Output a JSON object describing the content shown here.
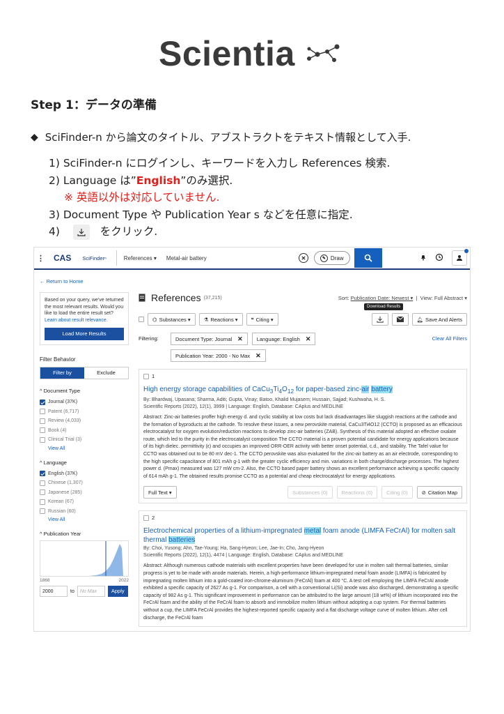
{
  "logo": {
    "text": "Scientia"
  },
  "step_title": "Step 1：データの準備",
  "bullet": {
    "mark": "◆",
    "text": "SciFinder-n から論文のタイトル、アブストラクトをテキスト情報として入手."
  },
  "steps": {
    "s1": "1) SciFinder-n にログインし、キーワードを入力し References 検索.",
    "s2_a": "2) Language は”",
    "s2_red": "English",
    "s2_b": "”のみ選択.",
    "note": "※ 英語以外は対応していません.",
    "s3": "3) Document Type や Publication Year s などを任意に指定.",
    "s4_num": "4)",
    "s4_text": "をクリック."
  },
  "app": {
    "brand": "CAS",
    "product": "SciFinderⁿ",
    "search_type": "References ▾",
    "search_value": "Metal-air battery",
    "draw_label": "Draw",
    "return_link": "←  Return to Home",
    "side_msg": "Based on your query, we've returned the most relevant results. Would you like to load the entire result set?",
    "learn_more": "Learn about result relevance.",
    "load_more": "Load More Results",
    "filter_behavior": "Filter Behavior",
    "filter_by": "Filter by",
    "exclude": "Exclude",
    "doc_type": {
      "header": "^  Document Type",
      "items": [
        {
          "label": "Journal (37K)",
          "on": true
        },
        {
          "label": "Patent (6,717)",
          "on": false
        },
        {
          "label": "Review (4,033)",
          "on": false
        },
        {
          "label": "Book (4)",
          "on": false
        },
        {
          "label": "Clinical Trial (3)",
          "on": false
        }
      ],
      "view_all": "View All"
    },
    "language": {
      "header": "^  Language",
      "items": [
        {
          "label": "English (37K)",
          "on": true
        },
        {
          "label": "Chinese (1,307)",
          "on": false
        },
        {
          "label": "Japanese (285)",
          "on": false
        },
        {
          "label": "Korean (67)",
          "on": false
        },
        {
          "label": "Russian (60)",
          "on": false
        }
      ],
      "view_all": "View All"
    },
    "pub_year": {
      "header": "^  Publication Year",
      "axis_start": "1868",
      "axis_end": "2022",
      "from_value": "2000",
      "to_label": "to",
      "to_placeholder": "No Max",
      "apply": "Apply"
    },
    "references_title": "References",
    "references_count": "(37,215)",
    "sort_label": "Sort: ",
    "sort_value": "Publication Date: Newest ▾",
    "view_label": "View: ",
    "view_value": "Full Abstract ▾",
    "tooltip": "Download Results",
    "toolbar": {
      "substances": "Substances ▾",
      "reactions": "Reactions ▾",
      "citing": "Citing ▾",
      "save_alerts": "Save And Alerts"
    },
    "filtering_label": "Filtering:",
    "chips": [
      "Document Type: Journal",
      "Language: English",
      "Publication Year: 2000 - No Max"
    ],
    "chip_close": "✕",
    "clear_all": "Clear All Filters",
    "results": [
      {
        "num": "1",
        "title_a": "High energy storage capabilities of CaCu",
        "title_sub1": "3",
        "title_b": "Ti",
        "title_sub2": "4",
        "title_c": "O",
        "title_sub3": "12",
        "title_d": " for paper-based zinc-",
        "title_hl1": "air",
        "title_e": " ",
        "title_hl2": "battery",
        "authors": "By: Bhardwaj, Upasana; Sharma, Aditi; Gupta, Vinay; Batoo, Khalid Mujasem; Hussain, Sajjad; Kushwaha, H. S.",
        "source": "Scientific Reports (2022), 12(1), 3999 | Language: English, Database: CAplus and MEDLINE",
        "abstract": "Abstract: Zinc-air batteries proffer high energy d. and cyclic stability at low costs but lack disadvantages like sluggish reactions at the cathode and the formation of byproducts at the cathode. To resolve these issues, a new perovskite material, CaCu3Ti4O12 (CCTO) is proposed as an efficacious electrocatalyst for oxygen evolution/reduction reactions to develop zinc-air batteries (ZAB). Synthesis of this material adopted an effective oxalate route, which led to the purity in the electrocatalyst composition The CCTO material is a proven potential candidate for energy applications because of its high dielec. permittivity (ε) and occupies an improved ORR-OER activity with better onset potential, c.d., and stability. The Tafel value for CCTO was obtained out to be 80 mV dec-1. The CCTO perovskite was also evaluated for the zinc-air battery as an air electrode, corresponding to the high specific capacitance of 801 mAh g-1 with the greater cyclic efficiency and min. variations in both charge/discharge processes. The highest power d. (Pmax) measured was 127 mW cm-2. Also, the CCTO based paper battery shows an excellent performance achieving a specific capacity of 614 mAh g-1. The obtained results promise CCTO as a potential and cheap electrocatalyst for energy applications.",
        "full_text": "Full Text ▾",
        "substances": "Substances (0)",
        "reactions": "Reactions (0)",
        "citing": "Citing (0)",
        "citation_map": "Citation Map"
      },
      {
        "num": "2",
        "title_a": "Electrochemical properties of a lithium-impregnated ",
        "title_hl1": "metal",
        "title_b": " foam anode (LIMFA FeCrAl) for molten salt thermal ",
        "title_hl2": "batteries",
        "authors": "By: Choi, Yusong; Ahn, Tae-Young; Ha, Sang-Hyeon; Lee, Jae-In; Cho, Jang-Hyeon",
        "source": "Scientific Reports (2022), 12(1), 4474 | Language: English, Database: CAplus and MEDLINE",
        "abstract": "Abstract: Although numerous cathode materials with excellent properties have been developed for use in molten salt thermal batteries, similar progress is yet to be made with anode materials. Herein, a high-performance lithium-impregnated metal foam anode (LIMFA) is fabricated by impregnating molten lithium into a gold-coated iron-chrome-aluminum (FeCrAl) foam at 400 °C. A test cell employing the LIMFA FeCrAl anode exhibited a specific capacity of 2627 As g-1. For comparison, a cell with a conventional Li(Si) anode was also discharged, demonstrating a specific capacity of 982 As g-1. This significant improvement in performance can be attributed to the large amount (18 wt%) of lithium incorporated into the FeCrAl foam and the ability of the FeCrAl foam to absorb and immobilize molten lithium without adopting a cup system. For thermal batteries without a cup, the LIMFA FeCrAl provides the highest-reported specific capacity and a flat discharge voltage curve of molten lithium. After cell discharge, the FeCrAl foam"
      }
    ]
  }
}
